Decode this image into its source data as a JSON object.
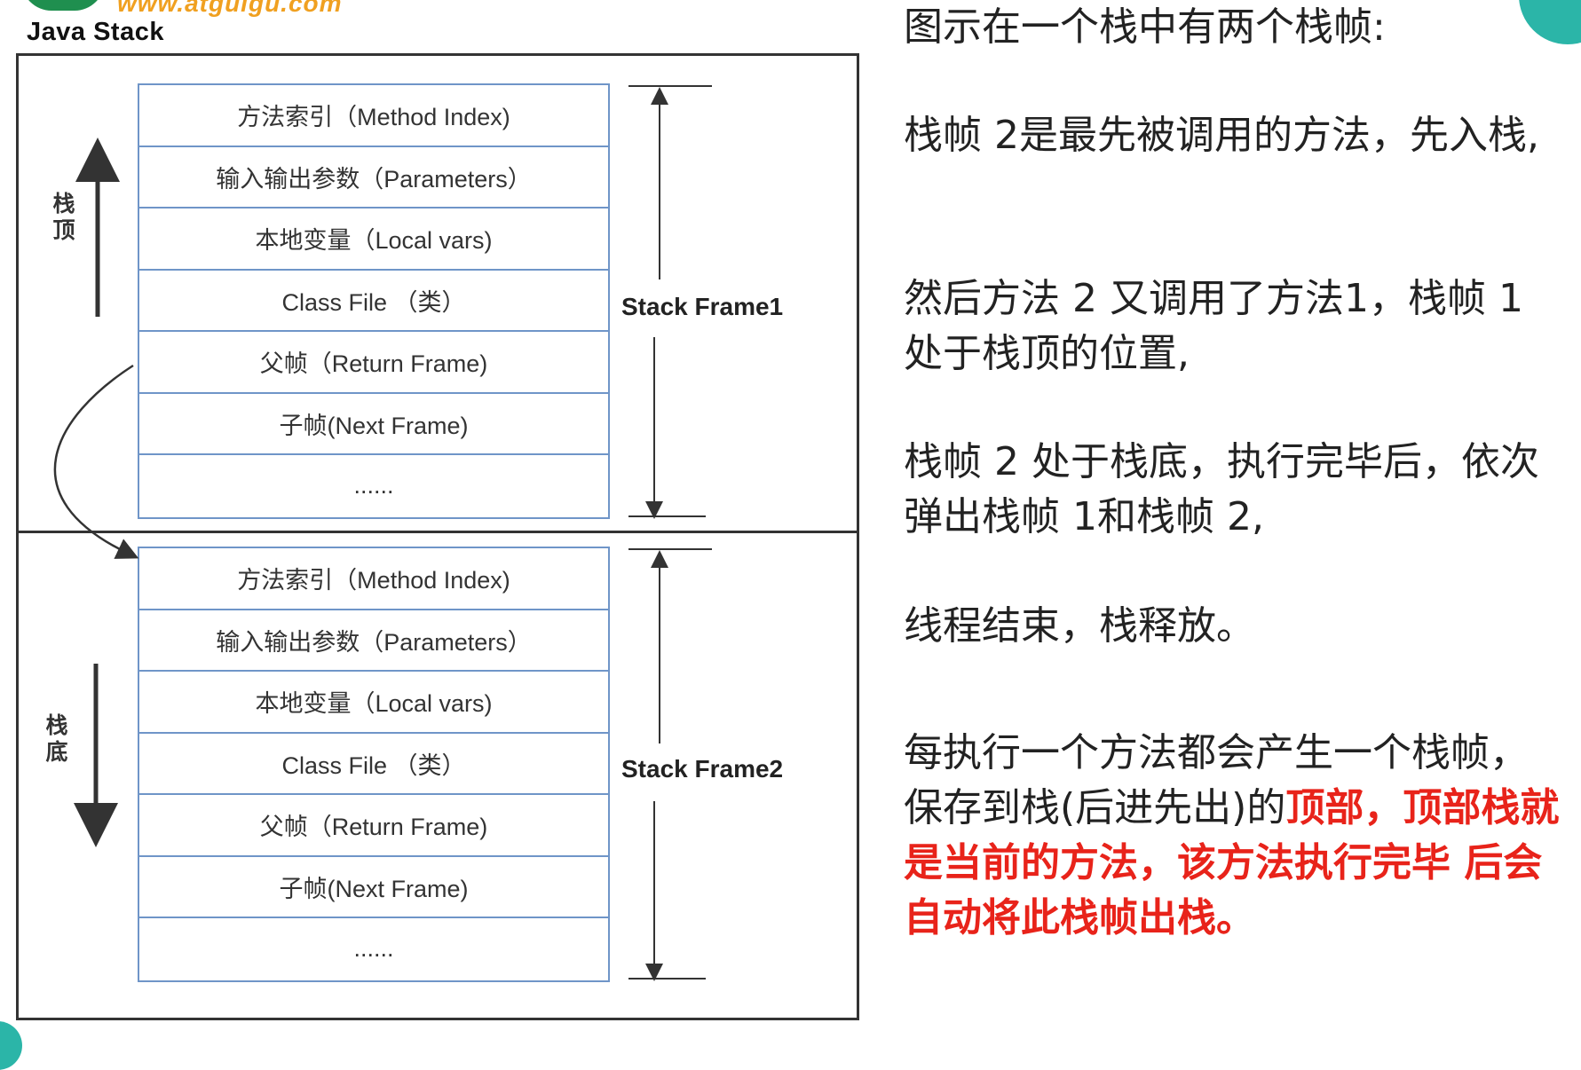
{
  "header": {
    "logo_url": "www.atguigu.com"
  },
  "diagram": {
    "title": "Java Stack",
    "top_side_label": "栈\n顶",
    "bottom_side_label": "栈\n底",
    "frame1_label": "Stack Frame1",
    "frame2_label": "Stack Frame2",
    "frame1_rows": [
      "方法索引（Method Index)",
      "输入输出参数（Parameters）",
      "本地变量（Local vars)",
      "Class File （类）",
      "父帧（Return Frame)",
      "子帧(Next Frame)",
      "......"
    ],
    "frame2_rows": [
      "方法索引（Method Index)",
      "输入输出参数（Parameters）",
      "本地变量（Local vars)",
      "Class File （类）",
      "父帧（Return Frame)",
      "子帧(Next Frame)",
      "......"
    ]
  },
  "explanation": {
    "p1": "图示在一个栈中有两个栈帧:",
    "p2": "栈帧 2是最先被调用的方法，先入栈,",
    "p3": "然后方法 2 又调用了方法1，栈帧 1处于栈顶的位置,",
    "p4": "栈帧 2 处于栈底，执行完毕后，依次弹出栈帧 1和栈帧 2,",
    "p5": "线程结束，栈释放。",
    "p6_plain": "每执行一个方法都会产生一个栈帧，保存到栈(后进先出)的",
    "p6_red": "顶部，顶部栈就是当前的方法，该方法执行完毕 后会自动将此栈帧出栈。"
  },
  "colors": {
    "accent_red": "#e8231a",
    "table_border": "#6f95c8",
    "logo_green": "#1f8f4f",
    "logo_orange": "#f0a020",
    "teal": "#2bb5a8"
  }
}
